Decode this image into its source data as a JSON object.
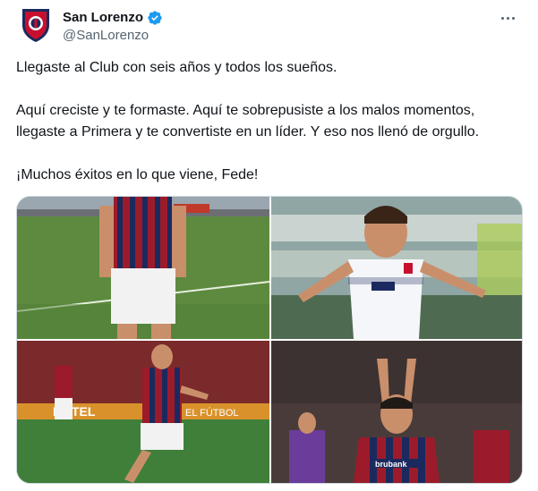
{
  "account": {
    "display_name": "San Lorenzo",
    "handle": "@SanLorenzo",
    "avatar_icon": "san-lorenzo-crest-icon",
    "verified_icon": "verified-badge-icon",
    "more_icon": "more-options-icon"
  },
  "tweet": {
    "paragraphs": [
      "Llegaste al Club con seis años y todos los sueños.",
      "Aquí creciste y te formaste. Aquí te sobrepusiste a los malos momentos, llegaste a Primera y te convertiste en un líder. Y eso nos llenó de orgullo.",
      "¡Muchos éxitos en lo que viene, Fede!"
    ]
  },
  "colors": {
    "accent": "#1d9bf0",
    "text": "#0f1419",
    "muted": "#536471",
    "club_blue": "#1b2a5e",
    "club_red": "#c8102e"
  }
}
